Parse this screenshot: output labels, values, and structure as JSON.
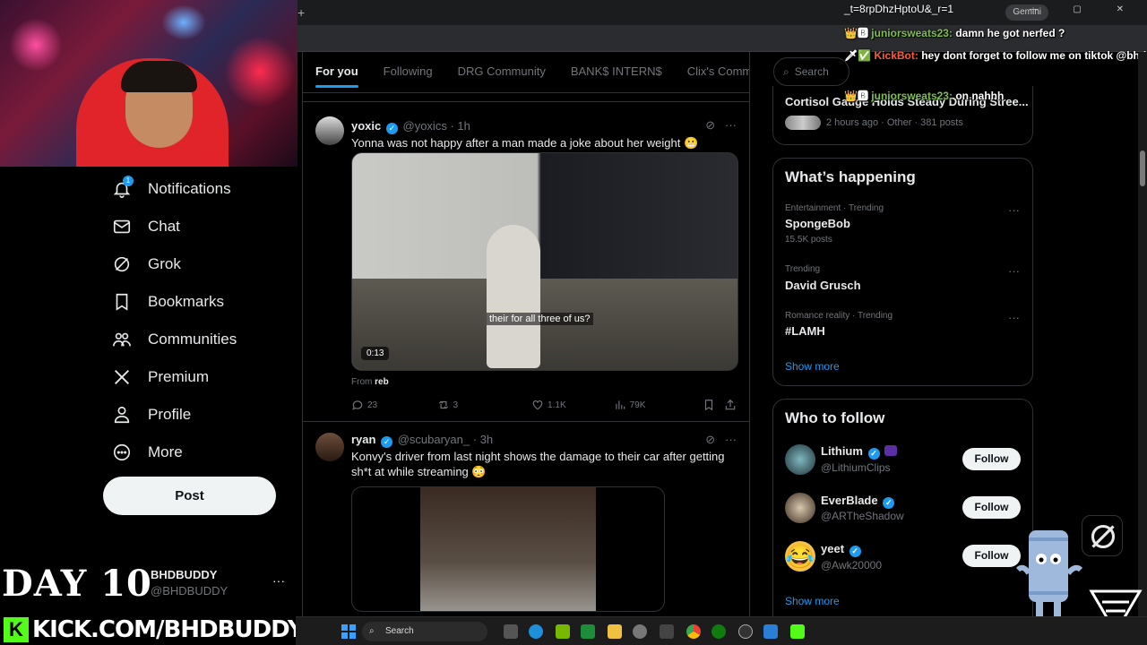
{
  "browser": {
    "url_fragment": "_t=8rpDhzHptoU&_r=1",
    "gemini_label": "Gemini",
    "new_tab": "+"
  },
  "nav": {
    "items": [
      {
        "label": "Notifications",
        "icon": "bell-icon",
        "badge": "1"
      },
      {
        "label": "Chat",
        "icon": "mail-icon"
      },
      {
        "label": "Grok",
        "icon": "grok-icon"
      },
      {
        "label": "Bookmarks",
        "icon": "bookmark-icon"
      },
      {
        "label": "Communities",
        "icon": "people-icon"
      },
      {
        "label": "Premium",
        "icon": "x-logo-icon"
      },
      {
        "label": "Profile",
        "icon": "person-icon"
      },
      {
        "label": "More",
        "icon": "more-circle-icon"
      }
    ],
    "post_label": "Post",
    "account": {
      "name": "BHDBUDDY",
      "handle": "@BHDBUDDY",
      "more": "···"
    }
  },
  "overlay": {
    "day": "DAY 10",
    "kick": "KICK.COM/BHDBUDDY",
    "kick_k": "K"
  },
  "tabs": [
    "For you",
    "Following",
    "DRG Community",
    "BANK$ INTERN$",
    "Clix's Commu"
  ],
  "tweets": [
    {
      "name": "yoxic",
      "handle": "@yoxics",
      "time": "· 1h",
      "text": "Yonna was not happy after a man made a joke about her weight 😬",
      "caption": "their for all three of us?",
      "duration": "0:13",
      "from_label": "From",
      "from_user": "reb",
      "replies": "23",
      "reposts": "3",
      "likes": "1.1K",
      "views": "79K"
    },
    {
      "name": "ryan",
      "handle": "@scubaryan_",
      "time": "· 3h",
      "text": "Konvy's driver from last night shows the damage to their car after getting sh*t at while streaming 😳"
    }
  ],
  "right": {
    "search_placeholder": "Search",
    "top_trend": {
      "title": "Cortisol Gauge Holds Steady During Stree...",
      "meta": "2 hours ago · Other · 381 posts"
    },
    "happening_title": "What’s happening",
    "trends": [
      {
        "meta": "Entertainment · Trending",
        "name": "SpongeBob",
        "count": "15.5K posts"
      },
      {
        "meta": "Trending",
        "name": "David Grusch",
        "count": ""
      },
      {
        "meta": "Romance reality · Trending",
        "name": "#LAMH",
        "count": ""
      }
    ],
    "show_more": "Show more",
    "who_title": "Who to follow",
    "follows": [
      {
        "name": "Lithium",
        "handle": "@LithiumClips"
      },
      {
        "name": "EverBlade",
        "handle": "@ARTheShadow"
      },
      {
        "name": "yeet",
        "handle": "@Awk20000"
      }
    ],
    "follow_label": "Follow"
  },
  "chat": [
    {
      "user": "juniorsweats23:",
      "msg": "damn he got nerfed ?",
      "type": "user"
    },
    {
      "user": "KickBot:",
      "msg": "hey dont forget to follow me on tiktok @bhdbuddy",
      "type": "bot"
    },
    {
      "user": "juniorsweats23:",
      "msg": "on nahhh",
      "type": "user"
    }
  ],
  "taskbar": {
    "search": "Search"
  },
  "colors": {
    "accent": "#1d9bf0",
    "background": "#000000",
    "kick_green": "#53fc18"
  }
}
